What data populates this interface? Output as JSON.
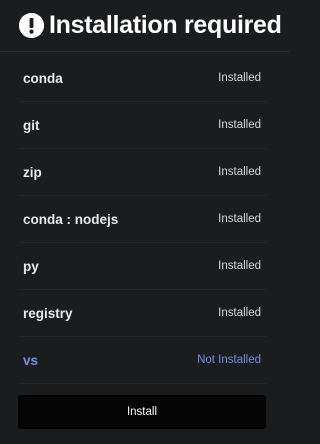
{
  "header": {
    "icon": "exclamation-circle-icon",
    "title": "Installation required"
  },
  "dependencies": [
    {
      "name": "conda",
      "status": "Installed"
    },
    {
      "name": "git",
      "status": "Installed"
    },
    {
      "name": "zip",
      "status": "Installed"
    },
    {
      "name": "conda : nodejs",
      "status": "Installed"
    },
    {
      "name": "py",
      "status": "Installed"
    },
    {
      "name": "registry",
      "status": "Installed"
    },
    {
      "name": "vs",
      "status": "Not Installed"
    }
  ],
  "actions": {
    "install_label": "Install"
  },
  "colors": {
    "background": "#1b1c1e",
    "not_installed": "#6e8fe8",
    "button_bg": "#050505"
  }
}
